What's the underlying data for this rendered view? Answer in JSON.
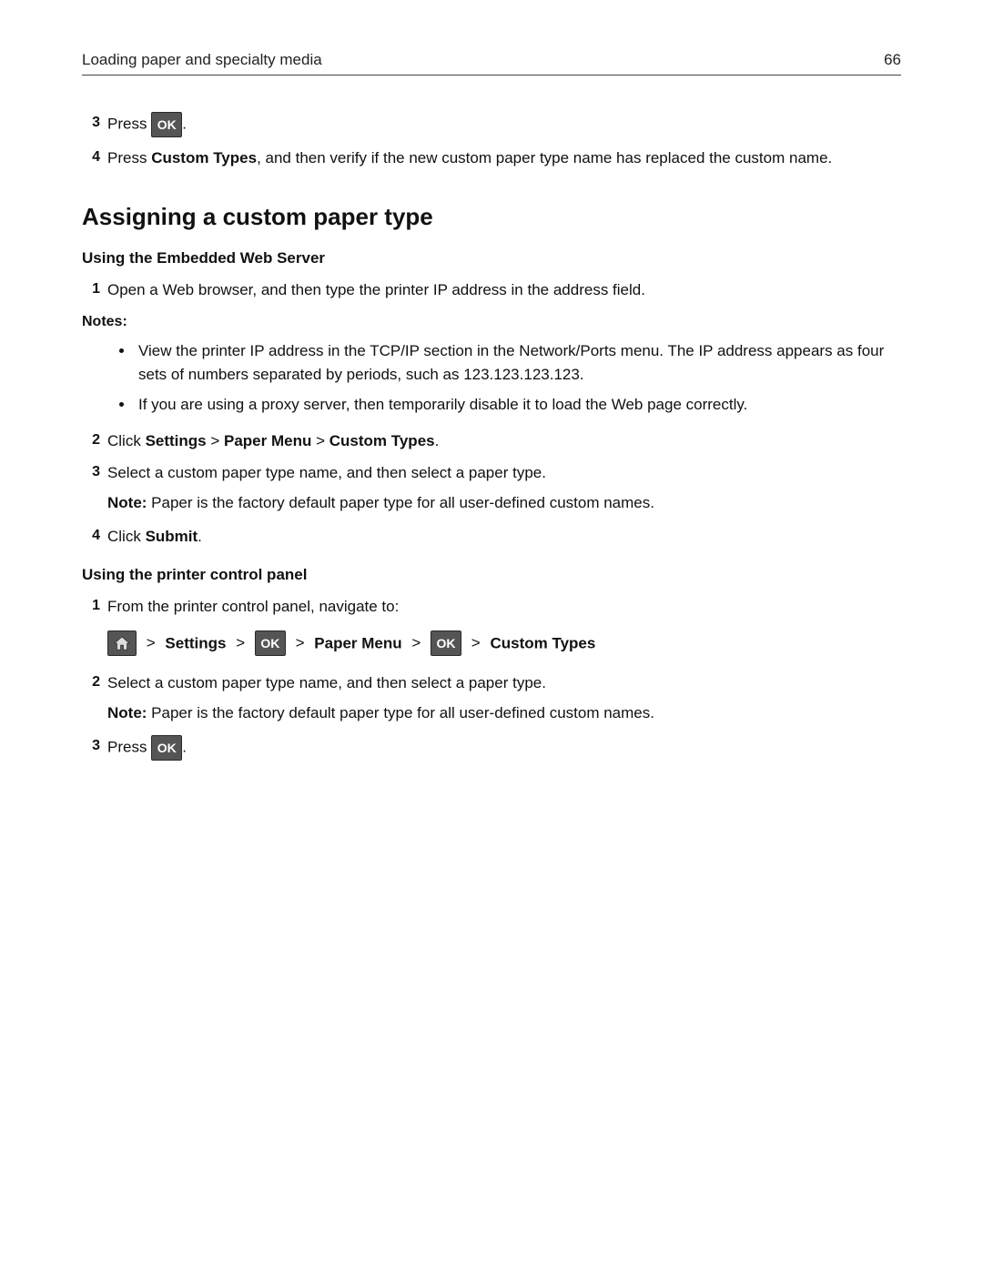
{
  "header": {
    "section_title": "Loading paper and specialty media",
    "page_number": "66"
  },
  "top_steps": {
    "s3": {
      "num": "3",
      "press": "Press ",
      "period": "."
    },
    "s4": {
      "num": "4",
      "t1": "Press ",
      "b1": "Custom Types",
      "t2": ", and then verify if the new custom paper type name has replaced the custom name."
    }
  },
  "ok_label": "OK",
  "section_title": "Assigning a custom paper type",
  "web": {
    "heading": "Using the Embedded Web Server",
    "s1": {
      "num": "1",
      "text": "Open a Web browser, and then type the printer IP address in the address field."
    },
    "notes_label": "Notes:",
    "bullet1": "View the printer IP address in the TCP/IP section in the Network/Ports menu. The IP address appears as four sets of numbers separated by periods, such as 123.123.123.123.",
    "bullet2": "If you are using a proxy server, then temporarily disable it to load the Web page correctly.",
    "s2": {
      "num": "2",
      "t1": "Click ",
      "b1": "Settings",
      "sep": " > ",
      "b2": "Paper Menu",
      "b3": "Custom Types",
      "period": "."
    },
    "s3": {
      "num": "3",
      "text": "Select a custom paper type name, and then select a paper type."
    },
    "note_line": {
      "label": "Note: ",
      "text": "Paper is the factory default paper type for all user-defined custom names."
    },
    "s4": {
      "num": "4",
      "t1": "Click ",
      "b1": "Submit",
      "period": "."
    }
  },
  "panel": {
    "heading": "Using the printer control panel",
    "s1": {
      "num": "1",
      "text": "From the printer control panel, navigate to:"
    },
    "path": {
      "sep": ">",
      "settings": "Settings",
      "paper_menu": "Paper Menu",
      "custom_types": "Custom Types"
    },
    "s2": {
      "num": "2",
      "text": "Select a custom paper type name, and then select a paper type."
    },
    "note_line": {
      "label": "Note: ",
      "text": "Paper is the factory default paper type for all user-defined custom names."
    },
    "s3": {
      "num": "3",
      "press": "Press ",
      "period": "."
    }
  }
}
